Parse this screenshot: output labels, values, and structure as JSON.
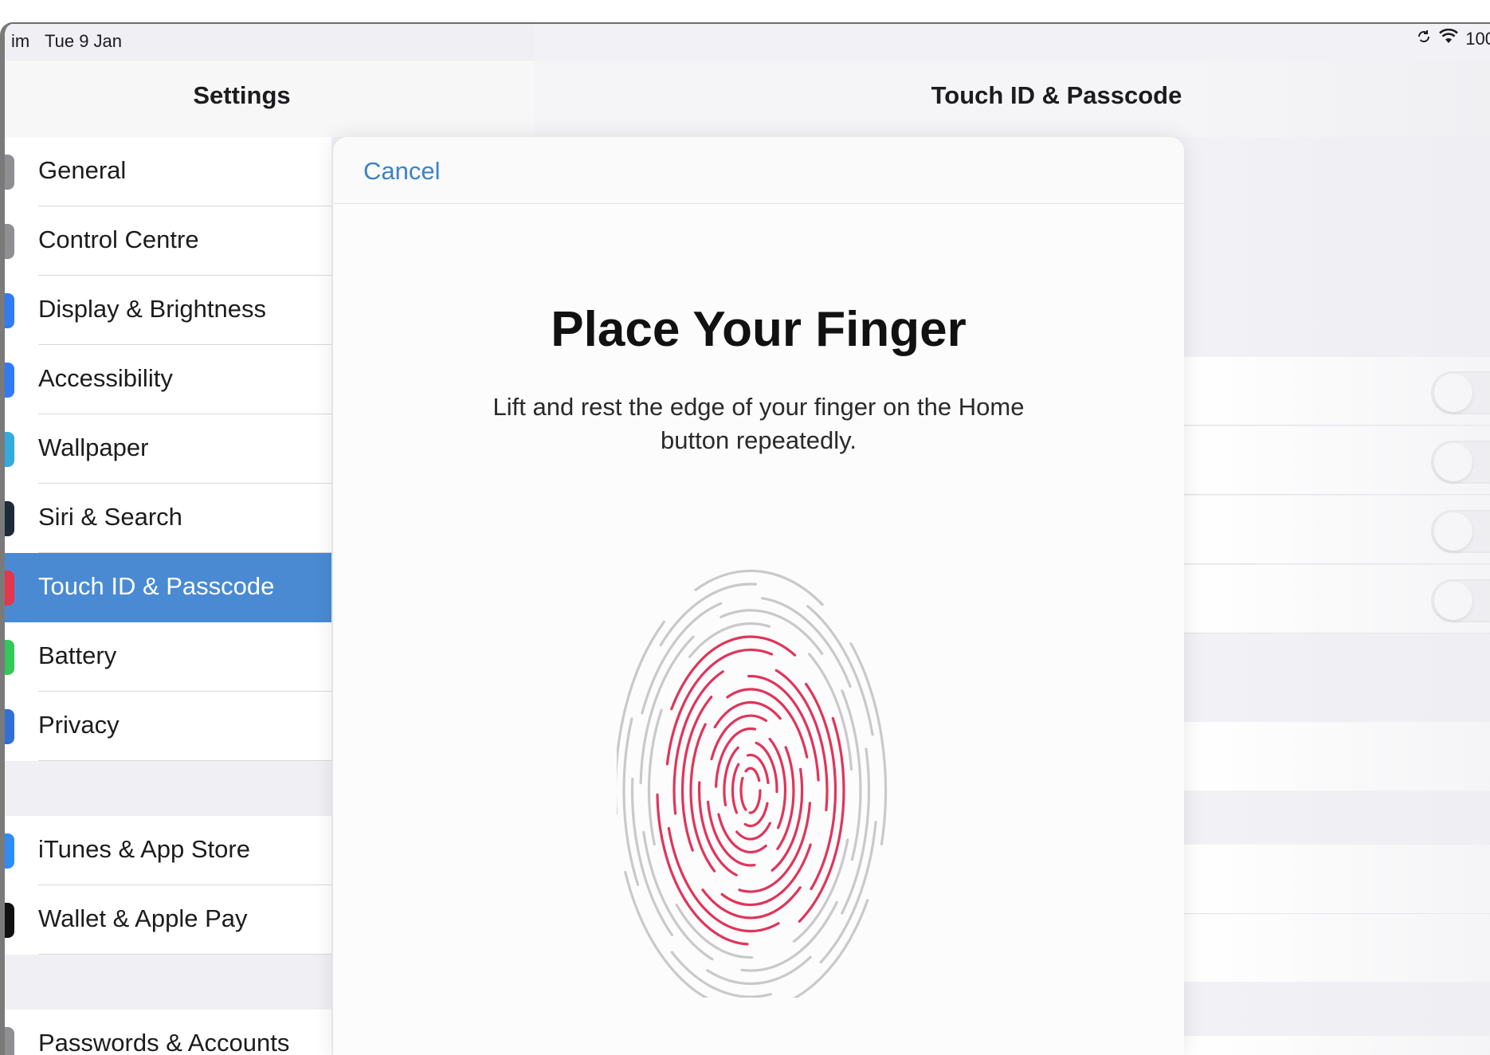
{
  "status_bar": {
    "time": "im",
    "date": "Tue 9 Jan",
    "battery": "100",
    "sync_icon": "sync-icon",
    "wifi_icon": "wifi-icon"
  },
  "sidebar": {
    "title": "Settings",
    "items": [
      {
        "label": "General",
        "icon": "gear-icon",
        "icon_color": "#8e8e93",
        "selected": false
      },
      {
        "label": "Control Centre",
        "icon": "control-centre-icon",
        "icon_color": "#8e8e93",
        "selected": false
      },
      {
        "label": "Display & Brightness",
        "icon": "brightness-icon",
        "icon_color": "#2f7cf6",
        "selected": false
      },
      {
        "label": "Accessibility",
        "icon": "accessibility-icon",
        "icon_color": "#2f7cf6",
        "selected": false
      },
      {
        "label": "Wallpaper",
        "icon": "wallpaper-icon",
        "icon_color": "#35aadc",
        "selected": false
      },
      {
        "label": "Siri & Search",
        "icon": "siri-icon",
        "icon_color": "#1c2a3a",
        "selected": false
      },
      {
        "label": "Touch ID & Passcode",
        "icon": "fingerprint-icon",
        "icon_color": "#e5364c",
        "selected": true
      },
      {
        "label": "Battery",
        "icon": "battery-icon",
        "icon_color": "#34c759",
        "selected": false
      },
      {
        "label": "Privacy",
        "icon": "hand-icon",
        "icon_color": "#2f6fd6",
        "selected": false
      },
      {
        "label": "iTunes & App Store",
        "icon": "app-store-icon",
        "icon_color": "#2f8cf6",
        "selected": false
      },
      {
        "label": "Wallet & Apple Pay",
        "icon": "wallet-icon",
        "icon_color": "#111111",
        "selected": false
      },
      {
        "label": "Passwords & Accounts",
        "icon": "key-icon",
        "icon_color": "#8e8e93",
        "selected": false
      }
    ]
  },
  "detail": {
    "title": "Touch ID & Passcode"
  },
  "modal": {
    "cancel_label": "Cancel",
    "heading": "Place Your Finger",
    "instruction": "Lift and rest the edge of your finger on the Home button repeatedly.",
    "fingerprint_icon": "fingerprint-icon",
    "accent_color": "#e0345a"
  }
}
